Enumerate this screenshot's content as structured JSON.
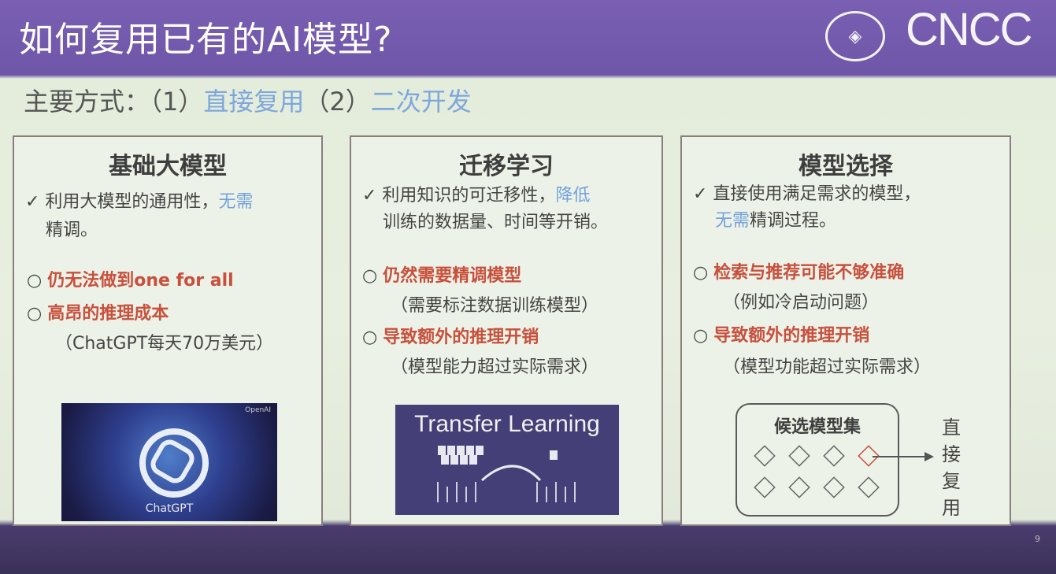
{
  "header": {
    "title": "如何复用已有的AI模型?",
    "logo_text": "CNCC"
  },
  "subtitle": {
    "prefix": "主要方式：（1）",
    "opt1": "直接复用",
    "mid": "（2）",
    "opt2": "二次开发"
  },
  "cards": [
    {
      "title": "基础大模型",
      "check_a": "✓ 利用大模型的通用性，",
      "check_b": "无需",
      "check_c": "精调。",
      "bullet1": "仍无法做到one for all",
      "bullet2": "高昂的推理成本",
      "note2": "（ChatGPT每天70万美元）",
      "image_brand": "OpenAI",
      "image_caption": "ChatGPT"
    },
    {
      "title": "迁移学习",
      "check_a": "✓ 利用知识的可迁移性，",
      "check_b": "降低",
      "check_c": "训练的数据量、时间等开销。",
      "bullet1": "仍然需要精调模型",
      "note1": "（需要标注数据训练模型）",
      "bullet2": "导致额外的推理开销",
      "note2": "（模型能力超过实际需求）",
      "image_caption": "Transfer Learning"
    },
    {
      "title": "模型选择",
      "check_a": "✓ 直接使用满足需求的模型，",
      "check_b": "无需",
      "check_c": "精调过程。",
      "bullet1": "检索与推荐可能不够准确",
      "note1": "（例如冷启动问题）",
      "bullet2": "导致额外的推理开销",
      "note2": "（模型功能超过实际需求）",
      "set_label": "候选模型集",
      "direct_label_1": "直",
      "direct_label_2": "接",
      "direct_label_3": "复",
      "direct_label_4": "用"
    }
  ],
  "bullet_marker": "○",
  "page_number": "9"
}
